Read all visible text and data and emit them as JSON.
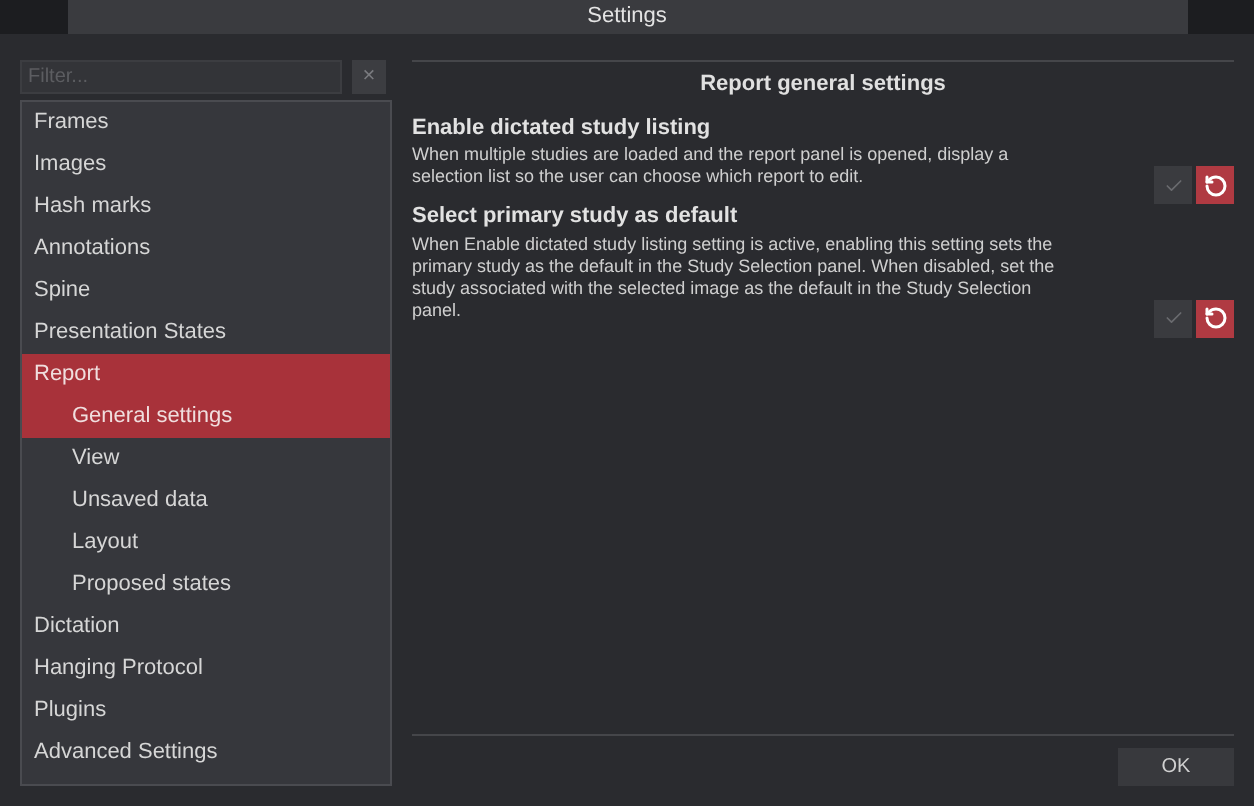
{
  "window": {
    "title": "Settings"
  },
  "filter": {
    "placeholder": "Filter...",
    "clear": "×"
  },
  "sidebar": {
    "items": [
      {
        "label": "Frames",
        "selected": false
      },
      {
        "label": "Images",
        "selected": false
      },
      {
        "label": "Hash marks",
        "selected": false
      },
      {
        "label": "Annotations",
        "selected": false
      },
      {
        "label": "Spine",
        "selected": false
      },
      {
        "label": "Presentation States",
        "selected": false
      },
      {
        "label": "Report",
        "selected": true,
        "children": [
          {
            "label": "General settings",
            "selected": true
          },
          {
            "label": "View",
            "selected": false
          },
          {
            "label": "Unsaved data",
            "selected": false
          },
          {
            "label": "Layout",
            "selected": false
          },
          {
            "label": "Proposed states",
            "selected": false
          }
        ]
      },
      {
        "label": "Dictation",
        "selected": false
      },
      {
        "label": "Hanging Protocol",
        "selected": false
      },
      {
        "label": "Plugins",
        "selected": false
      },
      {
        "label": "Advanced Settings",
        "selected": false
      }
    ]
  },
  "panel": {
    "title": "Report general settings",
    "settings": [
      {
        "title": "Enable dictated study listing",
        "description": "When multiple studies are loaded and the report panel is opened, display a selection list so the user can choose which report to edit."
      },
      {
        "title": "Select primary study as default",
        "description": "When Enable dictated study listing setting is active, enabling this setting sets the primary study as the default in the Study Selection panel. When disabled, set the study associated with the selected image as the default in the Study Selection panel."
      }
    ]
  },
  "buttons": [
    "OK"
  ]
}
